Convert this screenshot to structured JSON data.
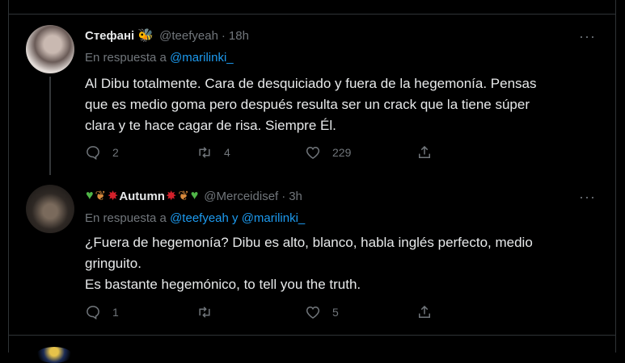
{
  "tweets": [
    {
      "name": "Стефані",
      "handle": "@teefyeah",
      "time": "18h",
      "reply_prefix": "En respuesta a",
      "reply_mentions": "@marilinki_",
      "text": [
        "Al Dibu totalmente. Cara de desquiciado y fuera de la hegemonía. Pensas",
        "que es medio goma pero después resulta ser un crack que la tiene súper",
        "clara y te hace cagar de risa. Siempre Él."
      ],
      "counts": {
        "replies": "2",
        "retweets": "4",
        "likes": "229"
      }
    },
    {
      "name": "Autumn",
      "handle": "@Merceidisef",
      "time": "3h",
      "reply_prefix": "En respuesta a",
      "reply_mention_1": "@teefyeah",
      "reply_and": "y",
      "reply_mention_2": "@marilinki_",
      "text": [
        "¿Fuera de hegemonía? Dibu es alto, blanco, habla inglés perfecto, medio",
        "gringuito.",
        "Es bastante hegemónico, to tell you the truth."
      ],
      "counts": {
        "replies": "1",
        "retweets": "",
        "likes": "5"
      }
    }
  ],
  "separator": "·",
  "more": "···",
  "icons": {
    "reply": "reply-icon",
    "retweet": "retweet-icon",
    "like": "like-icon",
    "share": "share-icon",
    "more": "more-icon",
    "bee": "bee-emoji",
    "green_heart": "green-heart-emoji",
    "leaves": "leaves-emoji",
    "maple_leaf": "maple-leaf-emoji"
  },
  "colors": {
    "background": "#000000",
    "text": "#e7e9ea",
    "muted": "#71767b",
    "link": "#1d9bf0",
    "border": "#2f3336"
  }
}
